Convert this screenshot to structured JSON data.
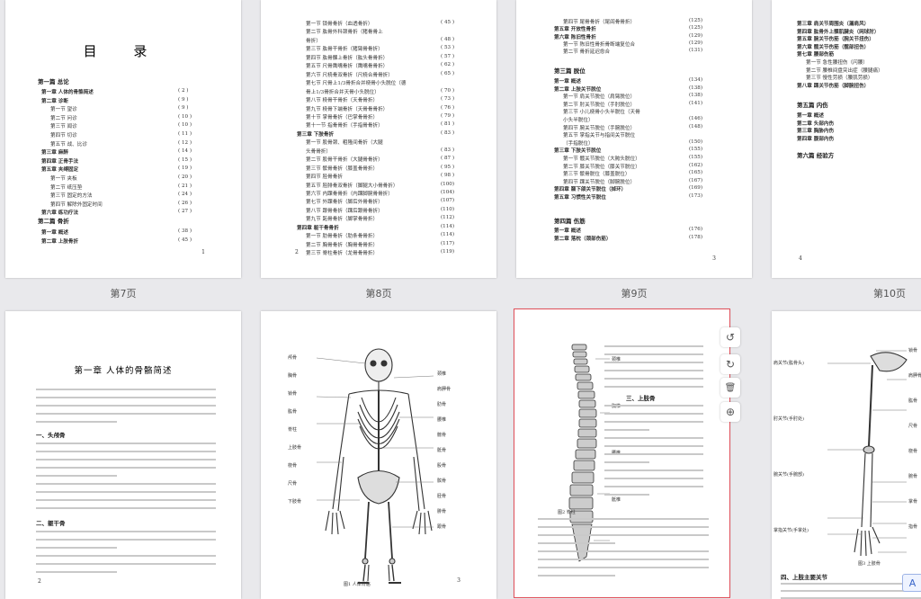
{
  "thumbnails": [
    {
      "label": "第7页"
    },
    {
      "label": "第8页"
    },
    {
      "label": "第9页"
    },
    {
      "label": "第10页"
    }
  ],
  "page7": {
    "title": "目 录",
    "part1": "第一篇 总论",
    "rows": [
      {
        "t": "第一章 人体的骨骼简述",
        "p": "( 2 )",
        "b": true
      },
      {
        "t": "第二章 诊断",
        "p": "( 9 )",
        "b": true
      },
      {
        "t": "第一节 望诊",
        "p": "( 9 )"
      },
      {
        "t": "第二节 问诊",
        "p": "( 10 )"
      },
      {
        "t": "第三节 闻诊",
        "p": "( 10 )"
      },
      {
        "t": "第四节 切诊",
        "p": "( 11 )"
      },
      {
        "t": "第五节 战、比诊",
        "p": "( 12 )"
      },
      {
        "t": "第三章 麻醉",
        "p": "( 14 )",
        "b": true
      },
      {
        "t": "第四章 正骨手法",
        "p": "( 15 )",
        "b": true
      },
      {
        "t": "第五章 夹缚固定",
        "p": "( 19 )",
        "b": true
      },
      {
        "t": "第一节 夹板",
        "p": "( 20 )"
      },
      {
        "t": "第二节 纸压垫",
        "p": "( 21 )"
      },
      {
        "t": "第三节 固定的方法",
        "p": "( 24 )"
      },
      {
        "t": "第四节 解除外固定时间",
        "p": "( 26 )"
      },
      {
        "t": "第六章 练功疗法",
        "p": "( 27 )",
        "b": true
      }
    ],
    "part2": "第二篇 骨折",
    "rows2": [
      {
        "t": "第一章 概述",
        "p": "( 38 )",
        "b": true
      },
      {
        "t": "第二章 上肢骨折",
        "p": "( 45 )",
        "b": true
      }
    ],
    "pageno": "1"
  },
  "page8": {
    "rows": [
      {
        "t": "第一节 锁骨骨折（血透骨折）",
        "p": "( 45 )"
      },
      {
        "t": "第二节 肱骨外科颈骨折（猪骨骨上",
        "p": ""
      },
      {
        "t": "骨折）",
        "p": "( 48 )"
      },
      {
        "t": "第三节 肱骨干骨折（猪臂骨骨折）",
        "p": "( 53 )"
      },
      {
        "t": "第四节 肱骨髁上骨折（肱头骨骨折）",
        "p": "( 57 )"
      },
      {
        "t": "第五节 尺骨鹰嘴骨折（鹰嘴骨骨折）",
        "p": "( 62 )"
      },
      {
        "t": "第六节 尺桡骨双骨折（尺桡合骨骨折）",
        "p": "( 65 )"
      },
      {
        "t": "第七节 尺骨上1/3骨折合并桡骨小头脱位（德",
        "p": ""
      },
      {
        "t": "骨上1/3骨折合并天骨小头脱位）",
        "p": "( 70 )"
      },
      {
        "t": "第八节 桡骨干骨折（天骨骨折）",
        "p": "( 73 )"
      },
      {
        "t": "第九节 桡骨下端骨折（天骨骨骨折）",
        "p": "( 76 )"
      },
      {
        "t": "第十节 掌骨骨折（巴掌骨骨折）",
        "p": "( 79 )"
      },
      {
        "t": "第十一节 指骨骨折（手指骨骨折）",
        "p": "( 81 )"
      },
      {
        "t": "第三章 下肢骨折",
        "p": "( 83 )",
        "b": true
      },
      {
        "t": "第一节 股骨颈、粗隆间骨折（大腿",
        "p": ""
      },
      {
        "t": "头骨骨折）",
        "p": "( 83 )"
      },
      {
        "t": "第二节 股骨干骨折（大腿骨骨折）",
        "p": "( 87 )"
      },
      {
        "t": "第三节 髌骨骨折（膝盖骨骨折）",
        "p": "( 95 )"
      },
      {
        "t": "第四节 胫骨骨折",
        "p": "( 98 )"
      },
      {
        "t": "第五节 胫腓骨双骨折（脚腿大小骨骨折）",
        "p": "(100)"
      },
      {
        "t": "第六节 内踝骨骨折（内踝脚腕骨骨折）",
        "p": "(104)"
      },
      {
        "t": "第七节 外踝骨折（脚后外骨骨折）",
        "p": "(107)"
      },
      {
        "t": "第八节 跟骨骨折（踝后跟骨骨折）",
        "p": "(110)"
      },
      {
        "t": "第九节 跖骨骨折（脚掌骨骨折）",
        "p": "(112)"
      },
      {
        "t": "第四章 躯干骨骨折",
        "p": "(114)",
        "b": true
      },
      {
        "t": "第一节 肋骨骨折（肋条骨骨折）",
        "p": "(114)"
      },
      {
        "t": "第二节 胸骨骨折（胸骨骨骨折）",
        "p": "(117)"
      },
      {
        "t": "第三节 脊柱骨折（龙骨骨骨折）",
        "p": "(119)"
      }
    ],
    "pageno": "2"
  },
  "page9": {
    "rows": [
      {
        "t": "第四节 尾骨骨折（尾闾骨骨折）",
        "p": "(125)"
      },
      {
        "t": "第五章 开放性骨折",
        "p": "(125)",
        "b": true
      },
      {
        "t": "第六章 陈旧性骨折",
        "p": "(129)",
        "b": true
      },
      {
        "t": "第一节 陈旧性骨折骨断端复位合",
        "p": "(129)"
      },
      {
        "t": "第二节 骨折延迟愈合",
        "p": "(131)"
      }
    ],
    "part3": "第三篇 脱位",
    "rows2": [
      {
        "t": "第一章 概述",
        "p": "(134)",
        "b": true
      },
      {
        "t": "第二章 上肢关节脱位",
        "p": "(138)",
        "b": true
      },
      {
        "t": "第一节 肩关节脱位（肩臂脱位）",
        "p": "(138)"
      },
      {
        "t": "第二节 肘关节脱位（手肘脱位）",
        "p": "(141)"
      },
      {
        "t": "第三节 小儿桡骨小头半脱位（天骨",
        "p": ""
      },
      {
        "t": "小头半脱位）",
        "p": "(146)"
      },
      {
        "t": "第四节 腕关节脱位（手腕脱位）",
        "p": "(148)"
      },
      {
        "t": "第五节 掌指关节与指间关节脱位",
        "p": ""
      },
      {
        "t": "（手指脱位）",
        "p": "(150)"
      },
      {
        "t": "第三章 下肢关节脱位",
        "p": "(155)",
        "b": true
      },
      {
        "t": "第一节 髋关节脱位（大胯头脱位）",
        "p": "(155)"
      },
      {
        "t": "第二节 膝关节脱位（膝关节脱位）",
        "p": "(162)"
      },
      {
        "t": "第三节 髌骨脱位（膝盖脱位）",
        "p": "(165)"
      },
      {
        "t": "第四节 踝关节脱位（脚腕脱位）",
        "p": "(167)"
      },
      {
        "t": "第四章 颞下颌关节脱位（掉环）",
        "p": "(169)",
        "b": true
      },
      {
        "t": "第五章 习惯性关节脱位",
        "p": "(173)",
        "b": true
      }
    ],
    "part4": "第四篇 伤筋",
    "rows3": [
      {
        "t": "第一章 概述",
        "p": "(176)",
        "b": true
      },
      {
        "t": "第二章 落枕（颈部伤筋）",
        "p": "(178)",
        "b": true
      }
    ],
    "pageno": "3"
  },
  "page10": {
    "rows": [
      {
        "t": "第三章 肩关节周围炎（漏肩风）",
        "b": true
      },
      {
        "t": "第四章 肱骨外上髁肌腱炎（网球肘）",
        "b": true
      },
      {
        "t": "第五章 腕关节伤筋（腕关节扭伤）",
        "b": true
      },
      {
        "t": "第六章 髋关节伤筋（髋部扭伤）",
        "b": true
      },
      {
        "t": "第七章 腰部伤筋",
        "b": true
      },
      {
        "t": "第一节 急性腰扭伤（闪腰）"
      },
      {
        "t": "第二节 腰椎间盘突出症（腰腿痛）"
      },
      {
        "t": "第三节 慢性劳损（腰肌劳损）"
      },
      {
        "t": "第八章 踝关节伤筋（脚腕扭伤）",
        "b": true
      }
    ],
    "part5": "第五篇 内伤",
    "rows2": [
      {
        "t": "第一章 概述",
        "b": true
      },
      {
        "t": "第二章 头部内伤",
        "b": true
      },
      {
        "t": "第三章 胸胁内伤",
        "b": true
      },
      {
        "t": "第四章 腹部内伤",
        "b": true
      }
    ],
    "part6": "第六篇 经验方",
    "pageno": "4"
  },
  "page11": {
    "chapter_title": "第一章 人体的骨骼简述",
    "section1": "一、头颅骨",
    "section2": "二、躯干骨",
    "pageno": "2"
  },
  "page12": {
    "fig_caption": "图1 人体骨骼",
    "labels_left": [
      "颅骨",
      "胸骨",
      "锁骨",
      "肱骨",
      "脊柱",
      "上肢骨",
      "桡骨",
      "尺骨",
      "下肢骨"
    ],
    "labels_right": [
      "颈椎",
      "肩胛骨",
      "肋骨",
      "腰椎",
      "髂骨",
      "骶骨",
      "股骨",
      "髌骨",
      "胫骨",
      "腓骨",
      "跟骨"
    ],
    "pageno": "3"
  },
  "page13": {
    "fig_caption": "图2 脊柱",
    "spine_labels": [
      "颈椎",
      "胸椎",
      "腰椎",
      "骶椎"
    ],
    "section": "三、上肢骨"
  },
  "page14": {
    "fig_caption": "图3 上肢骨",
    "section": "四、上肢主要关节",
    "labels_left": [
      "肩关节(肱骨头)",
      "肘关节(手肘处)",
      "腕关节(手腕部)",
      "掌指关节(手掌处)"
    ],
    "labels_right": [
      "锁骨",
      "肩胛骨",
      "肱骨",
      "尺骨",
      "桡骨",
      "腕骨",
      "掌骨",
      "指骨"
    ]
  },
  "toolbar": {
    "rotate_ccw": "↺",
    "rotate_cw": "↻",
    "delete": "🗑",
    "zoom": "⊕"
  },
  "corner_button": "A"
}
